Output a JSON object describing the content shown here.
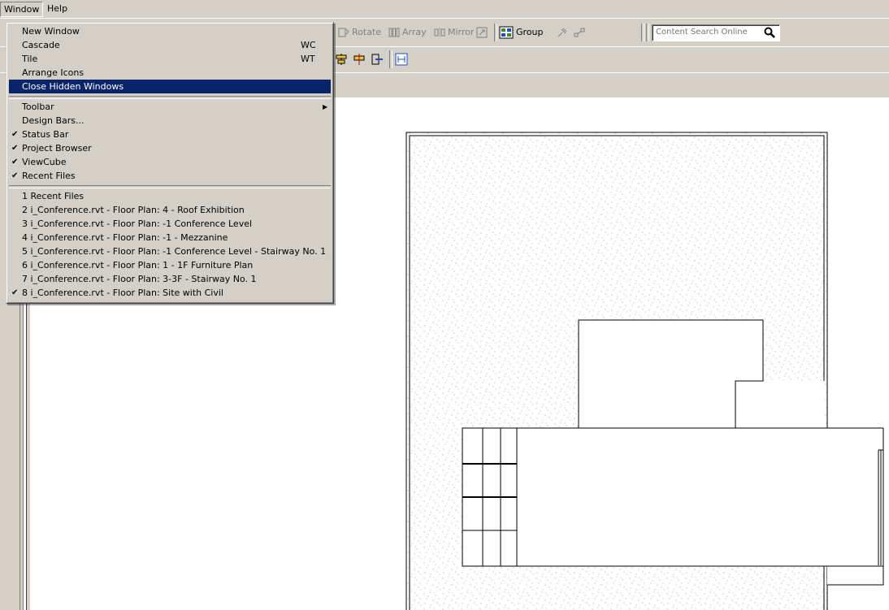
{
  "menubar": {
    "window": "Window",
    "help": "Help"
  },
  "toolbar": {
    "rotate": "Rotate",
    "array": "Array",
    "mirror": "Mirror",
    "group": "Group",
    "search_placeholder": "Content Search Online"
  },
  "menu": {
    "new_window": "New Window",
    "cascade": "Cascade",
    "cascade_shortcut": "WC",
    "tile": "Tile",
    "tile_shortcut": "WT",
    "arrange_icons": "Arrange Icons",
    "close_hidden": "Close Hidden Windows",
    "toolbar": "Toolbar",
    "design_bars": "Design Bars...",
    "status_bar": "Status Bar",
    "project_browser": "Project Browser",
    "viewcube": "ViewCube",
    "recent_files": "Recent Files",
    "files": [
      "1 Recent Files",
      "2 i_Conference.rvt - Floor Plan: 4 - Roof Exhibition",
      "3 i_Conference.rvt - Floor Plan: -1 Conference Level",
      "4 i_Conference.rvt - Floor Plan: -1 - Mezzanine",
      "5 i_Conference.rvt - Floor Plan: -1 Conference Level - Stairway No. 1",
      "6 i_Conference.rvt - Floor Plan: 1 - 1F Furniture Plan",
      "7 i_Conference.rvt - Floor Plan: 3-3F - Stairway No. 1",
      "8 i_Conference.rvt - Floor Plan: Site with Civil"
    ]
  },
  "colors": {
    "menu_bg": "#d4d0c8",
    "highlight": "#0a246a"
  }
}
